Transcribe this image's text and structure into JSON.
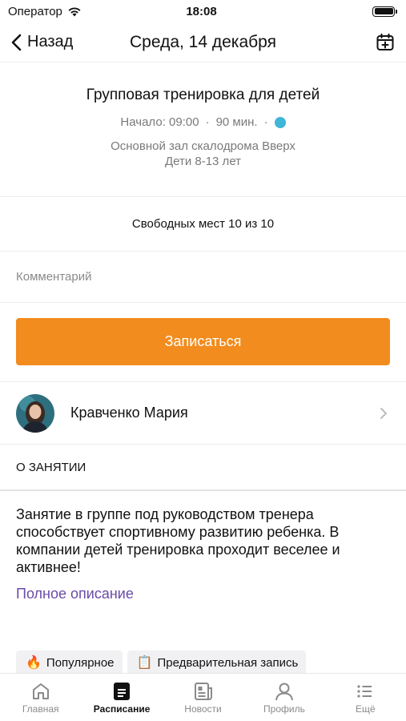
{
  "status_bar": {
    "carrier": "Оператор",
    "time": "18:08"
  },
  "nav": {
    "back_label": "Назад",
    "title": "Среда, 14 декабря",
    "calendar_icon": "calendar-plus-icon"
  },
  "event": {
    "title": "Групповая тренировка для детей",
    "start": "Начало: 09:00",
    "duration": "90 мин.",
    "status_color": "#3fb5d8",
    "place": "Основной зал скалодрома Вверх",
    "age": "Дети 8-13 лет"
  },
  "free_places": "Свободных мест 10 из 10",
  "comment": {
    "placeholder": "Комментарий",
    "value": ""
  },
  "signup_button": "Записаться",
  "accent_color": "#f28c1e",
  "trainer": {
    "name": "Кравченко Мария"
  },
  "about": {
    "header": "О ЗАНЯТИИ",
    "text": "Занятие в группе под руководством тренера способствует спортивному развитию ребенка. В компании детей тренировка проходит веселее и активнее!",
    "link": "Полное описание"
  },
  "tags": [
    {
      "icon": "🔥",
      "label": "Популярное"
    },
    {
      "icon": "📋",
      "label": "Предварительная запись"
    }
  ],
  "tabs": [
    {
      "label": "Главная",
      "icon": "home-icon",
      "active": false
    },
    {
      "label": "Расписание",
      "icon": "schedule-icon",
      "active": true
    },
    {
      "label": "Новости",
      "icon": "news-icon",
      "active": false
    },
    {
      "label": "Профиль",
      "icon": "profile-icon",
      "active": false
    },
    {
      "label": "Ещё",
      "icon": "more-icon",
      "active": false
    }
  ]
}
